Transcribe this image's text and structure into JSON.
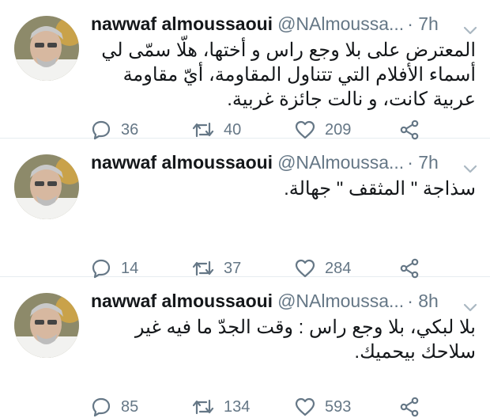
{
  "colors": {
    "name": "#14171a",
    "secondary": "#657786",
    "divider": "#e6ecf0"
  },
  "icons": [
    "reply-icon",
    "retweet-icon",
    "like-icon",
    "share-icon",
    "chevron-down-icon"
  ],
  "tweets": [
    {
      "name": "nawwaf almoussaoui",
      "handle": "@NAlmoussa...",
      "time": "· 7h",
      "text": "المعترض على بلا وجع راس و أختها، هلّا سمّى لي أسماء الأفلام التي تتناول المقاومة، أيّ مقاومة عربية كانت، و نالت جائزة غربية.",
      "replies": "36",
      "retweets": "40",
      "likes": "209"
    },
    {
      "name": "nawwaf almoussaoui",
      "handle": "@NAlmoussa...",
      "time": "· 7h",
      "text": "سذاجة \" المثقف \" جهالة.",
      "replies": "14",
      "retweets": "37",
      "likes": "284"
    },
    {
      "name": "nawwaf almoussaoui",
      "handle": "@NAlmoussa...",
      "time": "· 8h",
      "text": "بلا لبكي، بلا وجع راس : وقت الجدّ ما فيه غير سلاحك بيحميك.",
      "replies": "85",
      "retweets": "134",
      "likes": "593"
    }
  ]
}
